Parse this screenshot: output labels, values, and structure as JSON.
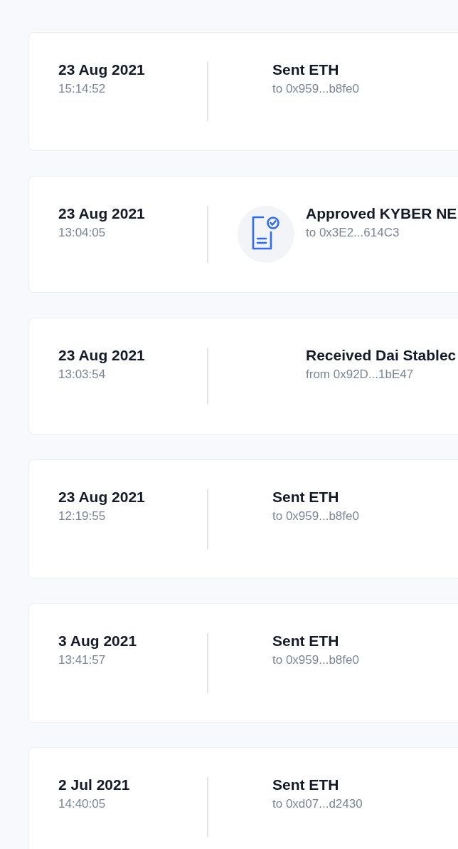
{
  "transactions": [
    {
      "date": "23 Aug 2021",
      "time": "15:14:52",
      "kind": "sent",
      "title": "Sent ETH",
      "address": "to 0x959...b8fe0"
    },
    {
      "date": "23 Aug 2021",
      "time": "13:04:05",
      "kind": "approved",
      "title": "Approved KYBER NE",
      "address": "to 0x3E2...614C3"
    },
    {
      "date": "23 Aug 2021",
      "time": "13:03:54",
      "kind": "received",
      "title": "Received Dai Stablec",
      "address": "from 0x92D...1bE47"
    },
    {
      "date": "23 Aug 2021",
      "time": "12:19:55",
      "kind": "sent",
      "title": "Sent ETH",
      "address": "to 0x959...b8fe0"
    },
    {
      "date": "3 Aug 2021",
      "time": "13:41:57",
      "kind": "sent",
      "title": "Sent ETH",
      "address": "to 0x959...b8fe0"
    },
    {
      "date": "2 Jul 2021",
      "time": "14:40:05",
      "kind": "sent",
      "title": "Sent ETH",
      "address": "to 0xd07...d2430"
    }
  ]
}
